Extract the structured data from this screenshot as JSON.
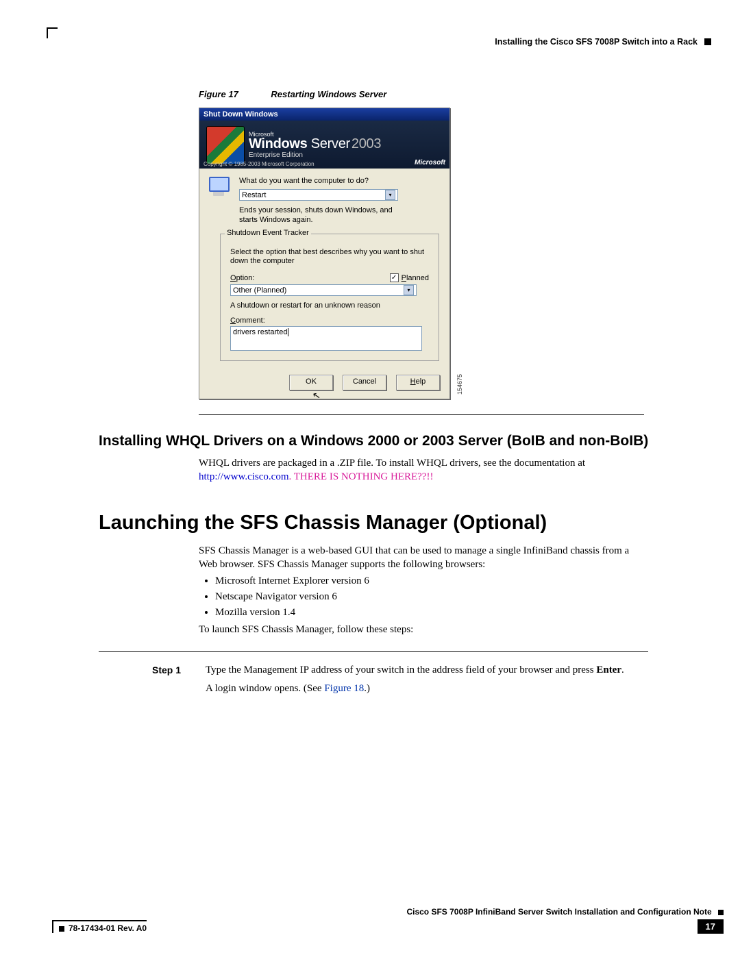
{
  "header": {
    "section_title": "Installing the Cisco SFS 7008P Switch into a Rack"
  },
  "figure": {
    "label": "Figure 17",
    "title": "Restarting Windows Server",
    "dialog_title": "Shut Down Windows",
    "brand_ms": "Microsoft",
    "brand_windows": "Windows",
    "brand_server": "Server",
    "brand_year": "2003",
    "brand_edition": "Enterprise Edition",
    "copyright": "Copyright © 1985-2003  Microsoft Corporation",
    "question": "What do you want the computer to do?",
    "action_value": "Restart",
    "action_desc": "Ends your session, shuts down Windows, and starts Windows again.",
    "tracker_legend": "Shutdown Event Tracker",
    "tracker_hint": "Select the option that best describes why you want to shut down the computer",
    "option_label": "Option:",
    "planned_label": "Planned",
    "option_value": "Other (Planned)",
    "reason_desc": "A shutdown or restart for an unknown reason",
    "comment_label": "Comment:",
    "comment_value": "drivers restarted",
    "btn_ok": "OK",
    "btn_cancel": "Cancel",
    "btn_help": "Help",
    "figure_id": "154675"
  },
  "whql": {
    "heading": "Installing WHQL Drivers on a Windows 2000 or 2003 Server (BoIB and non-BoIB)",
    "text_pre": "WHQL drivers are packaged in a .ZIP file. To install WHQL drivers, see the documentation at ",
    "url": "http://www.cisco.com",
    "dot": ". ",
    "note": "THERE IS NOTHING HERE??!!"
  },
  "sfs": {
    "heading": "Launching the SFS Chassis Manager (Optional)",
    "intro": "SFS Chassis Manager is a web-based GUI that can be used to manage a single InfiniBand chassis from a Web browser. SFS Chassis Manager supports the following browsers:",
    "bullets": [
      "Microsoft Internet Explorer version 6",
      "Netscape Navigator version 6",
      "Mozilla version 1.4"
    ],
    "launch_line": "To launch SFS Chassis Manager, follow these steps:",
    "step_label": "Step 1",
    "step_text_pre": "Type the Management IP address of your switch in the address field of your browser and press ",
    "step_enter": "Enter",
    "step_text_post": ".",
    "step_line2_pre": "A login window opens. (See ",
    "step_figref": "Figure 18",
    "step_line2_post": ".)"
  },
  "footer": {
    "doc_name": "Cisco SFS 7008P InfiniBand Server Switch Installation and Configuration Note",
    "rev": "78-17434-01 Rev. A0",
    "page": "17"
  }
}
